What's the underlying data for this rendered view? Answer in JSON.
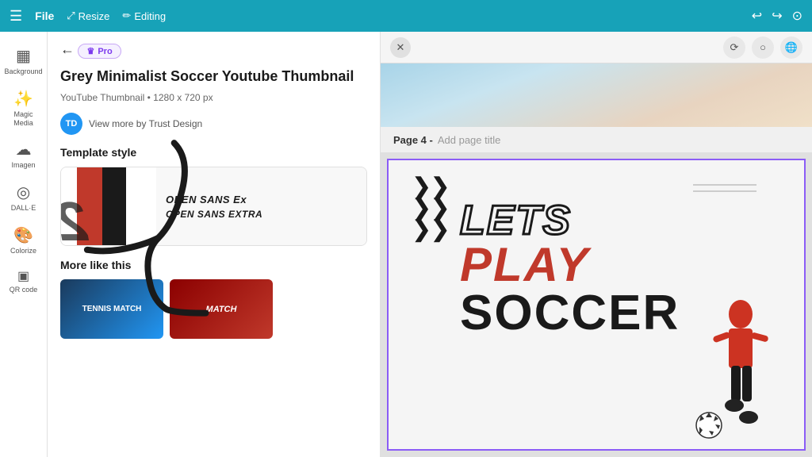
{
  "topbar": {
    "menu_icon": "☰",
    "file_label": "File",
    "resize_label": "Resize",
    "resize_icon": "⤢",
    "editing_label": "Editing",
    "editing_icon": "✏",
    "undo_icon": "↩",
    "redo_icon": "↪",
    "share_icon": "⊙"
  },
  "sidebar": {
    "items": [
      {
        "icon": "▦",
        "label": "Background"
      },
      {
        "icon": "✨",
        "label": "Magic Media"
      },
      {
        "icon": "☁",
        "label": "Imagen"
      },
      {
        "icon": "◎",
        "label": "DALL·E"
      },
      {
        "icon": "🎨",
        "label": "Colorize"
      },
      {
        "icon": "▣",
        "label": "QR code"
      }
    ]
  },
  "panel": {
    "back_arrow": "←",
    "pro_badge": "Pro",
    "crown_icon": "♛",
    "title": "Grey Minimalist Soccer Youtube Thumbnail",
    "meta": "YouTube Thumbnail • 1280 x 720 px",
    "author_initials": "TD",
    "author_name": "View more by Trust Design",
    "template_style_heading": "Template style",
    "style_font_line1": "OPEN SANS Ex",
    "style_font_line2": "OPEN SANS EXTRA",
    "more_like_heading": "More like this",
    "thumb1_label": "TENNIS MATCH",
    "thumb2_label": "MATCH"
  },
  "canvas": {
    "close_btn": "✕",
    "rotate_icon": "⟳",
    "circle_icon": "○",
    "globe_icon": "🌐",
    "page_label": "Page 4 -",
    "page_title_placeholder": "Add page title",
    "soccer_chevron1": "❯❯",
    "soccer_chevron2": "❯❯",
    "soccer_chevron3": "❯❯",
    "lets": "LETS",
    "play": "PLAY",
    "soccer": "SOCCER"
  },
  "colors": {
    "topbar_bg": "#17b8cc",
    "pro_badge_bg": "#f5f0ff",
    "pro_badge_border": "#c8a8f5",
    "pro_badge_text": "#7c3aed",
    "red_accent": "#c0392b",
    "canvas_border": "#8b5cf6",
    "author_avatar_bg": "#2196f3"
  }
}
